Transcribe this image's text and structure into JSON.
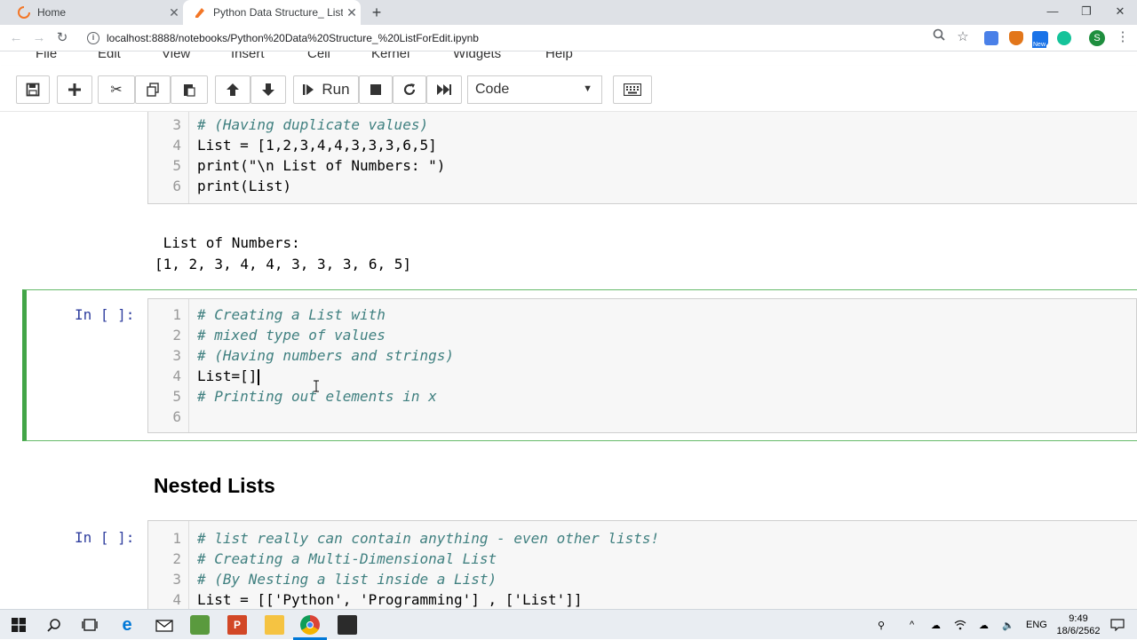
{
  "browser": {
    "tabs": [
      {
        "title": "Home",
        "active": false
      },
      {
        "title": "Python Data Structure_ ListForEd",
        "active": true
      }
    ],
    "url": "localhost:8888/notebooks/Python%20Data%20Structure_%20ListForEdit.ipynb",
    "profile_initial": "S",
    "new_badge": "New"
  },
  "jupyter": {
    "menu": [
      "File",
      "Edit",
      "View",
      "Insert",
      "Cell",
      "Kernel",
      "Widgets",
      "Help"
    ],
    "toolbar": {
      "run_label": "Run",
      "cell_type": "Code"
    }
  },
  "cells": {
    "cell1": {
      "lines": [
        {
          "n": "3",
          "text": "# (Having duplicate values)"
        },
        {
          "n": "4",
          "text": "List = [1,2,3,4,4,3,3,3,6,5]"
        },
        {
          "n": "5",
          "text": "print(\"\\n List of Numbers: \")"
        },
        {
          "n": "6",
          "text": "print(List)"
        }
      ],
      "output": [
        " List of Numbers: ",
        "[1, 2, 3, 4, 4, 3, 3, 3, 6, 5]"
      ]
    },
    "cell2": {
      "prompt": "In [ ]:",
      "lines": [
        {
          "n": "1",
          "text": "# Creating a List with"
        },
        {
          "n": "2",
          "text": "# mixed type of values"
        },
        {
          "n": "3",
          "text": "# (Having numbers and strings)"
        },
        {
          "n": "4",
          "text": "List=[]"
        },
        {
          "n": "5",
          "text": "# Printing out elements in x"
        },
        {
          "n": "6",
          "text": ""
        }
      ]
    },
    "heading": "Nested Lists",
    "cell3": {
      "prompt": "In [ ]:",
      "lines": [
        {
          "n": "1",
          "text": "# list really can contain anything - even other lists!"
        },
        {
          "n": "2",
          "text": "# Creating a Multi-Dimensional List"
        },
        {
          "n": "3",
          "text": "# (By Nesting a list inside a List)"
        },
        {
          "n": "4",
          "text": "List = [['Python', 'Programming'] , ['List']]"
        }
      ]
    }
  },
  "taskbar": {
    "lang": "ENG",
    "time": "9:49",
    "date": "18/6/2562"
  }
}
